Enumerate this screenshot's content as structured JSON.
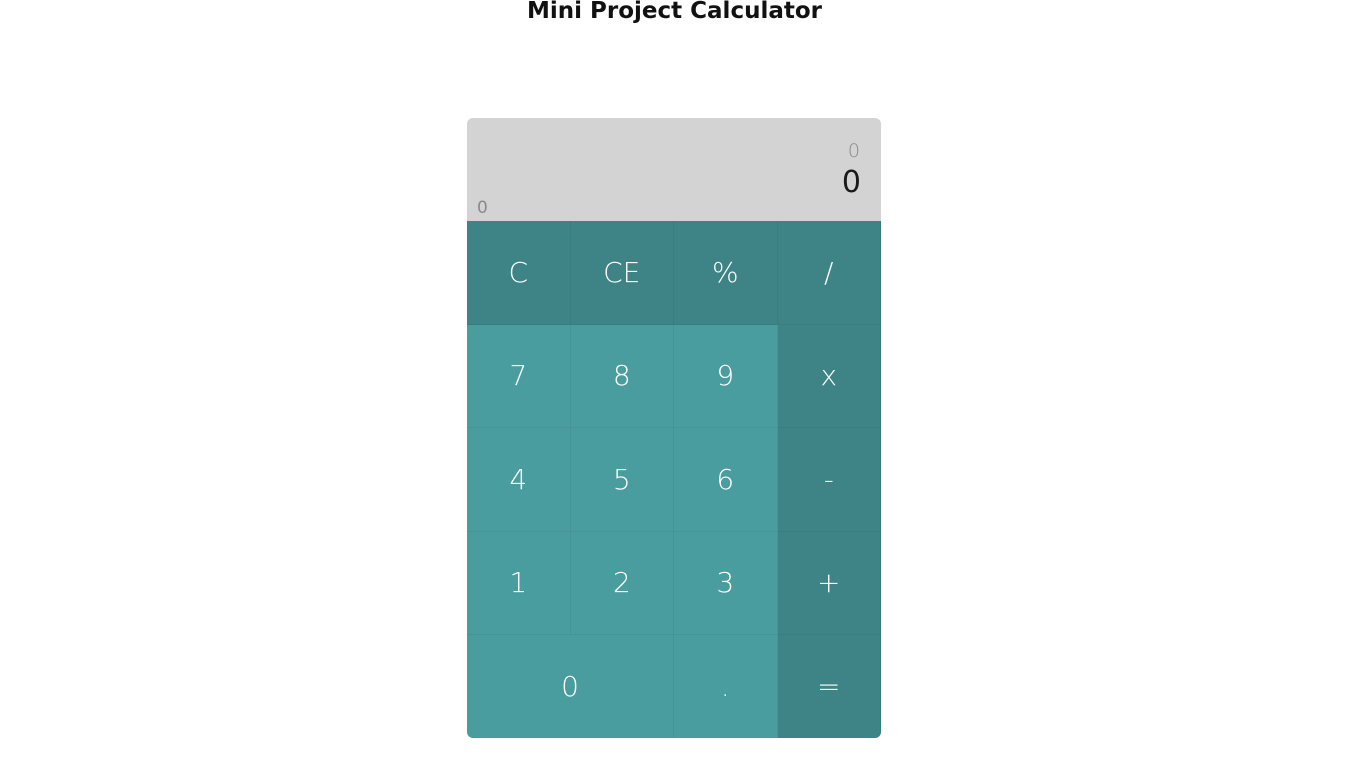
{
  "page": {
    "title": "Mini Project Calculator"
  },
  "display": {
    "previous": "0",
    "current": "0",
    "memory": "0"
  },
  "colors": {
    "display_bg": "#d3d3d3",
    "number_key": "#4a9d9f",
    "operator_key": "#3e8487",
    "key_text": "#ffffff"
  },
  "keys": {
    "clear": "C",
    "clear_entry": "CE",
    "percent": "%",
    "divide": "/",
    "seven": "7",
    "eight": "8",
    "nine": "9",
    "multiply": "x",
    "four": "4",
    "five": "5",
    "six": "6",
    "subtract": "-",
    "one": "1",
    "two": "2",
    "three": "3",
    "add": "+",
    "zero": "0",
    "decimal": ".",
    "equals": "="
  }
}
